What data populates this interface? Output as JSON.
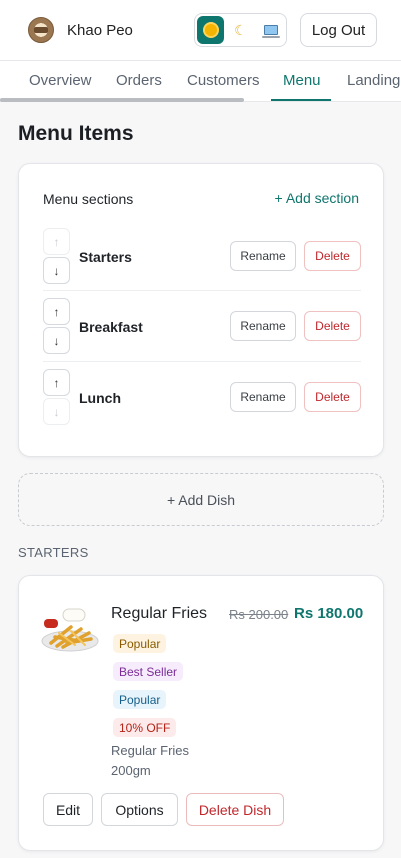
{
  "header": {
    "brand": "Khao Peo",
    "theme_options": [
      {
        "name": "light",
        "icon": "sun-icon",
        "active": true
      },
      {
        "name": "dark",
        "icon": "moon-icon",
        "active": false
      },
      {
        "name": "system",
        "icon": "laptop-icon",
        "active": false
      }
    ],
    "logout_label": "Log Out"
  },
  "tabs": [
    {
      "label": "Overview"
    },
    {
      "label": "Orders"
    },
    {
      "label": "Customers"
    },
    {
      "label": "Menu",
      "active": true
    },
    {
      "label": "Landing"
    }
  ],
  "page": {
    "title": "Menu Items"
  },
  "sections_card": {
    "title": "Menu sections",
    "add_label": "+ Add section",
    "rows": [
      {
        "name": "Starters",
        "up": "↑",
        "down": "↓",
        "rename": "Rename",
        "delete": "Delete"
      },
      {
        "name": "Breakfast",
        "up": "↑",
        "down": "↓",
        "rename": "Rename",
        "delete": "Delete"
      },
      {
        "name": "Lunch",
        "up": "↑",
        "down": "↓",
        "rename": "Rename",
        "delete": "Delete"
      }
    ]
  },
  "add_dish_label": "+ Add Dish",
  "section_label": "STARTERS",
  "dish": {
    "name": "Regular Fries",
    "old_price": "Rs 200.00",
    "new_price": "Rs 180.00",
    "badges": [
      "Popular",
      "Best Seller",
      "Popular",
      "10% OFF"
    ],
    "desc_line1": "Regular Fries",
    "desc_line2": "200gm",
    "edit_label": "Edit",
    "options_label": "Options",
    "delete_label": "Delete Dish"
  },
  "colors": {
    "accent": "#0f766e",
    "danger": "#c0282d"
  }
}
